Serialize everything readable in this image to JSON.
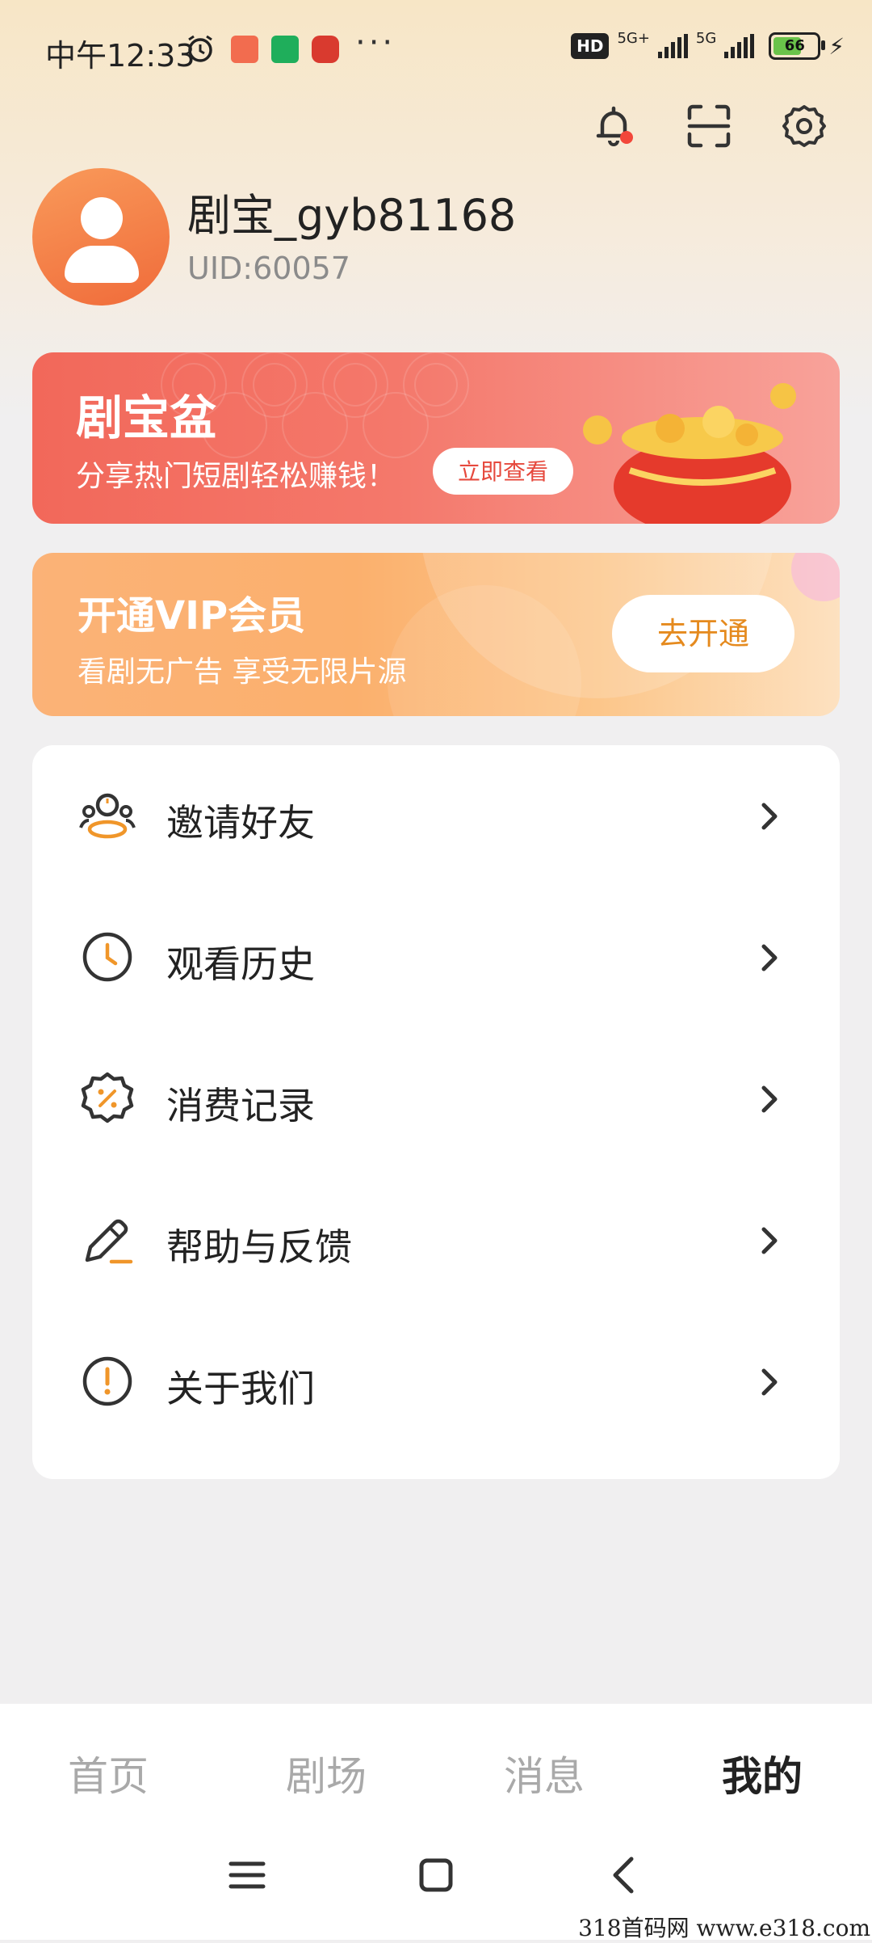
{
  "status_bar": {
    "time": "中午12:33",
    "more": "···",
    "hd_badge": "HD",
    "network_1": "5G+",
    "network_2": "5G",
    "battery": "66"
  },
  "header": {
    "icons": [
      "bell-icon",
      "scan-icon",
      "settings-icon"
    ],
    "notification_dot_color": "#f2473a"
  },
  "profile": {
    "username": "剧宝_gyb81168",
    "uid": "UID:60057"
  },
  "treasure_banner": {
    "title": "剧宝盆",
    "subtitle": "分享热门短剧轻松赚钱！",
    "button": "立即查看"
  },
  "vip_banner": {
    "title": "开通VIP会员",
    "subtitle": "看剧无广告 享受无限片源",
    "button": "去开通"
  },
  "menu": {
    "items": [
      {
        "label": "邀请好友",
        "icon": "invite-friends-icon"
      },
      {
        "label": "观看历史",
        "icon": "clock-icon"
      },
      {
        "label": "消费记录",
        "icon": "discount-badge-icon"
      },
      {
        "label": "帮助与反馈",
        "icon": "pen-icon"
      },
      {
        "label": "关于我们",
        "icon": "info-exclamation-icon"
      }
    ]
  },
  "bottom_nav": {
    "tabs": [
      {
        "label": "首页",
        "active": false
      },
      {
        "label": "剧场",
        "active": false
      },
      {
        "label": "消息",
        "active": false
      },
      {
        "label": "我的",
        "active": true
      }
    ]
  },
  "watermark": "318首码网 www.e318.com",
  "colors": {
    "accent_orange": "#e58a1e",
    "treasure_red": "#f2685a",
    "vip_orange": "#fbb277"
  }
}
